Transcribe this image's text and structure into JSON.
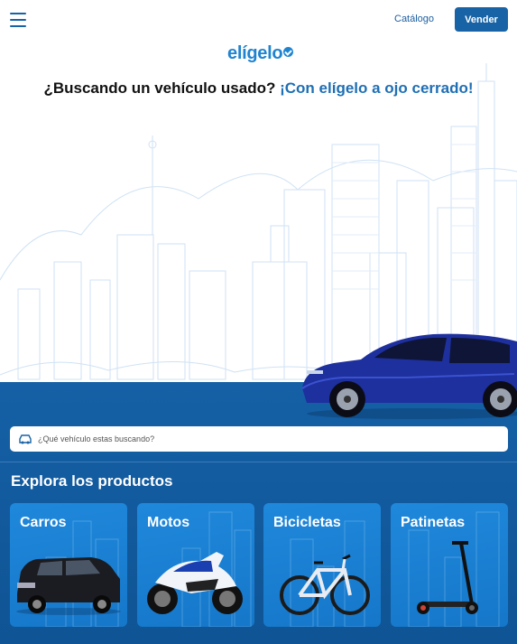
{
  "header": {
    "menu_icon": "hamburger-menu-icon",
    "catalog_label": "Catálogo",
    "sell_label": "Vender"
  },
  "hero": {
    "logo_text": "elígelo",
    "tagline_question": "¿Buscando un vehículo usado?",
    "tagline_answer": "¡Con elígelo a ojo cerrado!"
  },
  "search": {
    "icon": "car-icon",
    "placeholder": "¿Qué vehículo estas buscando?",
    "value": ""
  },
  "products": {
    "title": "Explora los productos",
    "items": [
      {
        "label": "Carros",
        "icon": "suv-image"
      },
      {
        "label": "Motos",
        "icon": "motorcycle-image"
      },
      {
        "label": "Bicicletas",
        "icon": "bicycle-image"
      },
      {
        "label": "Patinetas",
        "icon": "scooter-image"
      }
    ]
  },
  "colors": {
    "primary": "#1763a6",
    "accent": "#1f84d0",
    "band": "#1560a6",
    "card": "#1f88db"
  }
}
